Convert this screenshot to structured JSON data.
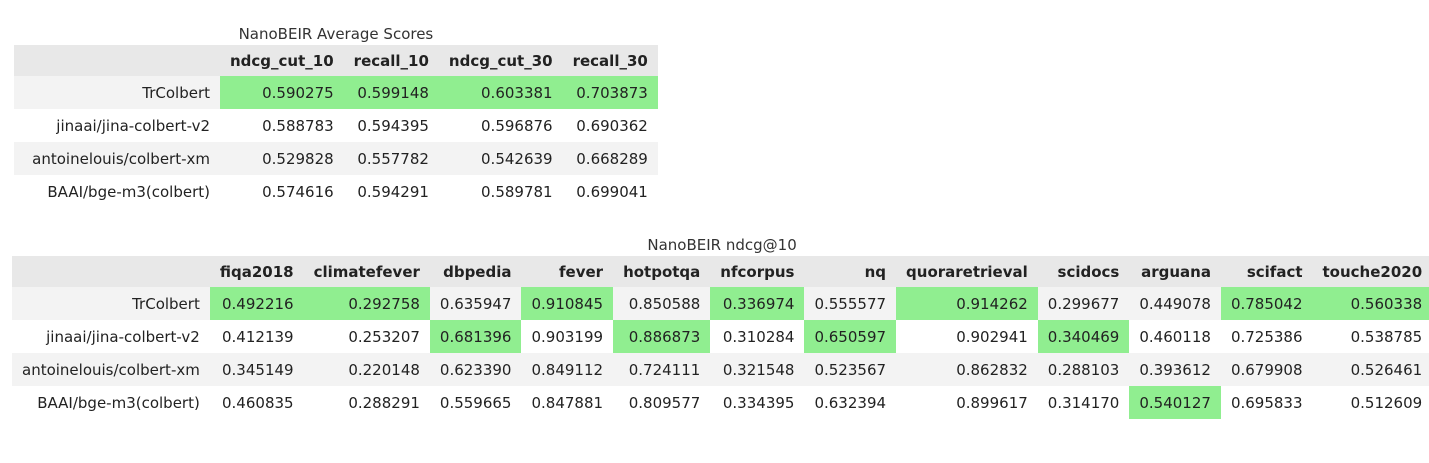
{
  "colors": {
    "highlight": "#90ee90",
    "header_bg": "#e8e8e8",
    "row_odd_bg": "#f3f3f3",
    "row_even_bg": "#ffffff"
  },
  "tables": [
    {
      "caption": "NanoBEIR Average Scores",
      "columns": [
        "ndcg_cut_10",
        "recall_10",
        "ndcg_cut_30",
        "recall_30"
      ],
      "rows": [
        {
          "name": "TrColbert",
          "values": [
            "0.590275",
            "0.599148",
            "0.603381",
            "0.703873"
          ],
          "highlight": [
            true,
            true,
            true,
            true
          ]
        },
        {
          "name": "jinaai/jina-colbert-v2",
          "values": [
            "0.588783",
            "0.594395",
            "0.596876",
            "0.690362"
          ],
          "highlight": [
            false,
            false,
            false,
            false
          ]
        },
        {
          "name": "antoinelouis/colbert-xm",
          "values": [
            "0.529828",
            "0.557782",
            "0.542639",
            "0.668289"
          ],
          "highlight": [
            false,
            false,
            false,
            false
          ]
        },
        {
          "name": "BAAI/bge-m3(colbert)",
          "values": [
            "0.574616",
            "0.594291",
            "0.589781",
            "0.699041"
          ],
          "highlight": [
            false,
            false,
            false,
            false
          ]
        }
      ]
    },
    {
      "caption": "NanoBEIR ndcg@10",
      "columns": [
        "fiqa2018",
        "climatefever",
        "dbpedia",
        "fever",
        "hotpotqa",
        "nfcorpus",
        "nq",
        "quoraretrieval",
        "scidocs",
        "arguana",
        "scifact",
        "touche2020"
      ],
      "rows": [
        {
          "name": "TrColbert",
          "values": [
            "0.492216",
            "0.292758",
            "0.635947",
            "0.910845",
            "0.850588",
            "0.336974",
            "0.555577",
            "0.914262",
            "0.299677",
            "0.449078",
            "0.785042",
            "0.560338"
          ],
          "highlight": [
            true,
            true,
            false,
            true,
            false,
            true,
            false,
            true,
            false,
            false,
            true,
            true
          ]
        },
        {
          "name": "jinaai/jina-colbert-v2",
          "values": [
            "0.412139",
            "0.253207",
            "0.681396",
            "0.903199",
            "0.886873",
            "0.310284",
            "0.650597",
            "0.902941",
            "0.340469",
            "0.460118",
            "0.725386",
            "0.538785"
          ],
          "highlight": [
            false,
            false,
            true,
            false,
            true,
            false,
            true,
            false,
            true,
            false,
            false,
            false
          ]
        },
        {
          "name": "antoinelouis/colbert-xm",
          "values": [
            "0.345149",
            "0.220148",
            "0.623390",
            "0.849112",
            "0.724111",
            "0.321548",
            "0.523567",
            "0.862832",
            "0.288103",
            "0.393612",
            "0.679908",
            "0.526461"
          ],
          "highlight": [
            false,
            false,
            false,
            false,
            false,
            false,
            false,
            false,
            false,
            false,
            false,
            false
          ]
        },
        {
          "name": "BAAI/bge-m3(colbert)",
          "values": [
            "0.460835",
            "0.288291",
            "0.559665",
            "0.847881",
            "0.809577",
            "0.334395",
            "0.632394",
            "0.899617",
            "0.314170",
            "0.540127",
            "0.695833",
            "0.512609"
          ],
          "highlight": [
            false,
            false,
            false,
            false,
            false,
            false,
            false,
            false,
            false,
            true,
            false,
            false
          ]
        }
      ]
    }
  ]
}
